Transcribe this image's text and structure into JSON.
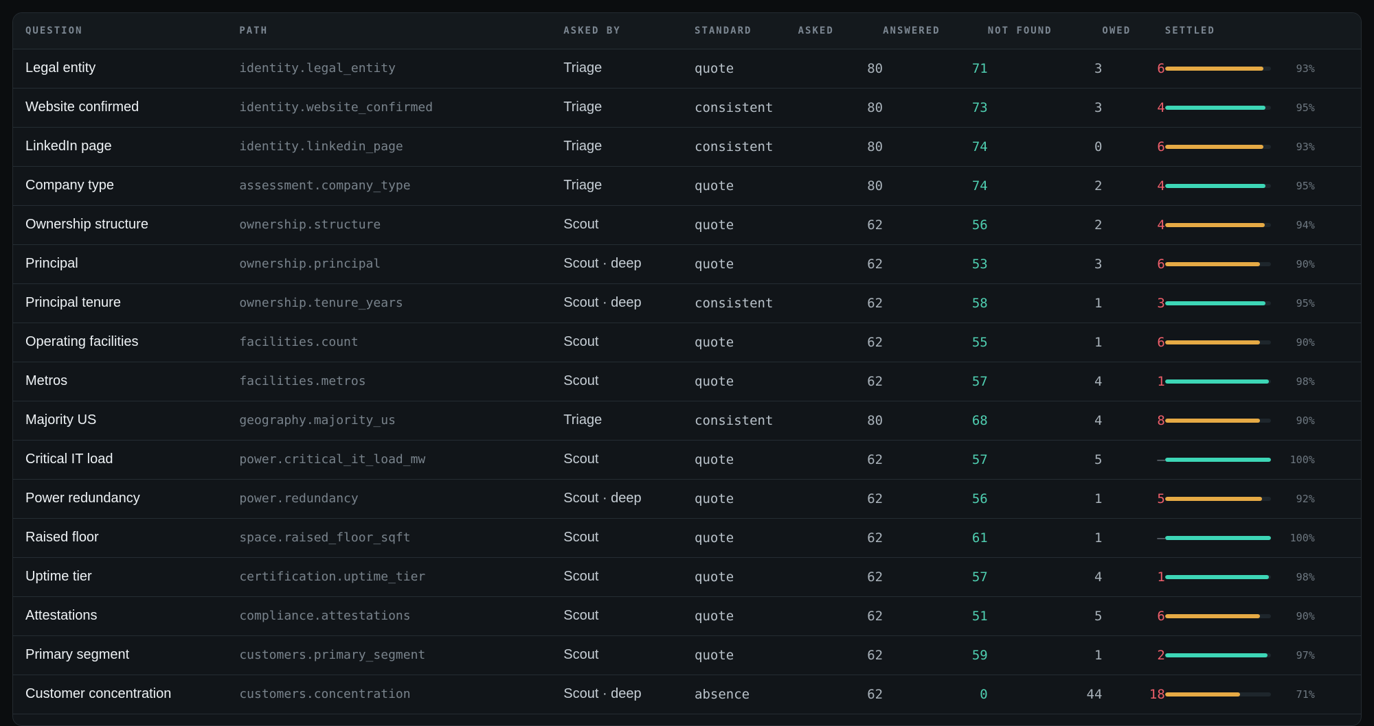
{
  "columns": {
    "question": "QUESTION",
    "path": "PATH",
    "asked_by": "ASKED BY",
    "standard": "STANDARD",
    "asked": "ASKED",
    "answered": "ANSWERED",
    "not_found": "NOT FOUND",
    "owed": "OWED",
    "settled": "SETTLED"
  },
  "colors": {
    "green": "#3dd6b6",
    "amber": "#e6aa45",
    "red": "#ef5f6b"
  },
  "rows": [
    {
      "question": "Legal entity",
      "path": "identity.legal_entity",
      "asked_by": "Triage",
      "standard": "quote",
      "asked": "80",
      "answered": "71",
      "not_found": "3",
      "owed": "6",
      "settled_pct": "93%",
      "settled": 0.93,
      "bar_color": "amber"
    },
    {
      "question": "Website confirmed",
      "path": "identity.website_confirmed",
      "asked_by": "Triage",
      "standard": "consistent",
      "asked": "80",
      "answered": "73",
      "not_found": "3",
      "owed": "4",
      "settled_pct": "95%",
      "settled": 0.95,
      "bar_color": "green"
    },
    {
      "question": "LinkedIn page",
      "path": "identity.linkedin_page",
      "asked_by": "Triage",
      "standard": "consistent",
      "asked": "80",
      "answered": "74",
      "not_found": "0",
      "owed": "6",
      "settled_pct": "93%",
      "settled": 0.93,
      "bar_color": "amber"
    },
    {
      "question": "Company type",
      "path": "assessment.company_type",
      "asked_by": "Triage",
      "standard": "quote",
      "asked": "80",
      "answered": "74",
      "not_found": "2",
      "owed": "4",
      "settled_pct": "95%",
      "settled": 0.95,
      "bar_color": "green"
    },
    {
      "question": "Ownership structure",
      "path": "ownership.structure",
      "asked_by": "Scout",
      "standard": "quote",
      "asked": "62",
      "answered": "56",
      "not_found": "2",
      "owed": "4",
      "settled_pct": "94%",
      "settled": 0.94,
      "bar_color": "amber"
    },
    {
      "question": "Principal",
      "path": "ownership.principal",
      "asked_by": "Scout · deep",
      "standard": "quote",
      "asked": "62",
      "answered": "53",
      "not_found": "3",
      "owed": "6",
      "settled_pct": "90%",
      "settled": 0.9,
      "bar_color": "amber"
    },
    {
      "question": "Principal tenure",
      "path": "ownership.tenure_years",
      "asked_by": "Scout · deep",
      "standard": "consistent",
      "asked": "62",
      "answered": "58",
      "not_found": "1",
      "owed": "3",
      "settled_pct": "95%",
      "settled": 0.95,
      "bar_color": "green"
    },
    {
      "question": "Operating facilities",
      "path": "facilities.count",
      "asked_by": "Scout",
      "standard": "quote",
      "asked": "62",
      "answered": "55",
      "not_found": "1",
      "owed": "6",
      "settled_pct": "90%",
      "settled": 0.9,
      "bar_color": "amber"
    },
    {
      "question": "Metros",
      "path": "facilities.metros",
      "asked_by": "Scout",
      "standard": "quote",
      "asked": "62",
      "answered": "57",
      "not_found": "4",
      "owed": "1",
      "settled_pct": "98%",
      "settled": 0.98,
      "bar_color": "green"
    },
    {
      "question": "Majority US",
      "path": "geography.majority_us",
      "asked_by": "Triage",
      "standard": "consistent",
      "asked": "80",
      "answered": "68",
      "not_found": "4",
      "owed": "8",
      "settled_pct": "90%",
      "settled": 0.9,
      "bar_color": "amber"
    },
    {
      "question": "Critical IT load",
      "path": "power.critical_it_load_mw",
      "asked_by": "Scout",
      "standard": "quote",
      "asked": "62",
      "answered": "57",
      "not_found": "5",
      "owed": "—",
      "settled_pct": "100%",
      "settled": 1.0,
      "bar_color": "green"
    },
    {
      "question": "Power redundancy",
      "path": "power.redundancy",
      "asked_by": "Scout · deep",
      "standard": "quote",
      "asked": "62",
      "answered": "56",
      "not_found": "1",
      "owed": "5",
      "settled_pct": "92%",
      "settled": 0.92,
      "bar_color": "amber"
    },
    {
      "question": "Raised floor",
      "path": "space.raised_floor_sqft",
      "asked_by": "Scout",
      "standard": "quote",
      "asked": "62",
      "answered": "61",
      "not_found": "1",
      "owed": "—",
      "settled_pct": "100%",
      "settled": 1.0,
      "bar_color": "green"
    },
    {
      "question": "Uptime tier",
      "path": "certification.uptime_tier",
      "asked_by": "Scout",
      "standard": "quote",
      "asked": "62",
      "answered": "57",
      "not_found": "4",
      "owed": "1",
      "settled_pct": "98%",
      "settled": 0.98,
      "bar_color": "green"
    },
    {
      "question": "Attestations",
      "path": "compliance.attestations",
      "asked_by": "Scout",
      "standard": "quote",
      "asked": "62",
      "answered": "51",
      "not_found": "5",
      "owed": "6",
      "settled_pct": "90%",
      "settled": 0.9,
      "bar_color": "amber"
    },
    {
      "question": "Primary segment",
      "path": "customers.primary_segment",
      "asked_by": "Scout",
      "standard": "quote",
      "asked": "62",
      "answered": "59",
      "not_found": "1",
      "owed": "2",
      "settled_pct": "97%",
      "settled": 0.97,
      "bar_color": "green"
    },
    {
      "question": "Customer concentration",
      "path": "customers.concentration",
      "asked_by": "Scout · deep",
      "standard": "absence",
      "asked": "62",
      "answered": "0",
      "not_found": "44",
      "owed": "18",
      "settled_pct": "71%",
      "settled": 0.71,
      "bar_color": "amber"
    }
  ]
}
